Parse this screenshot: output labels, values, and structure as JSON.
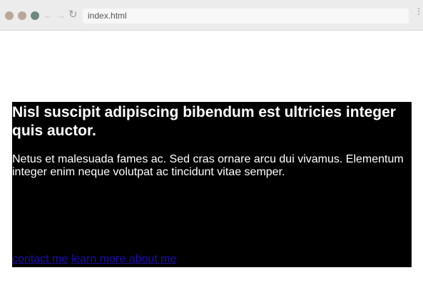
{
  "browser": {
    "address": "index.html",
    "back_icon": "←",
    "forward_icon": "→",
    "reload_icon": "↻",
    "menu_icon": "⋮",
    "traffic_colors": [
      "#b9a79c",
      "#b9a79c",
      "#6e8a7b"
    ]
  },
  "hero": {
    "title": "Nisl suscipit adipiscing bibendum est ultricies integer quis auctor.",
    "text": "Netus et malesuada fames ac. Sed cras ornare arcu dui vivamus. Elementum integer enim neque volutpat ac tincidunt vitae semper.",
    "links": {
      "contact": "contact me",
      "learn_more": "learn more about me"
    },
    "background": "#000000",
    "text_color": "#ffffff",
    "link_color": "#1a0dab"
  }
}
